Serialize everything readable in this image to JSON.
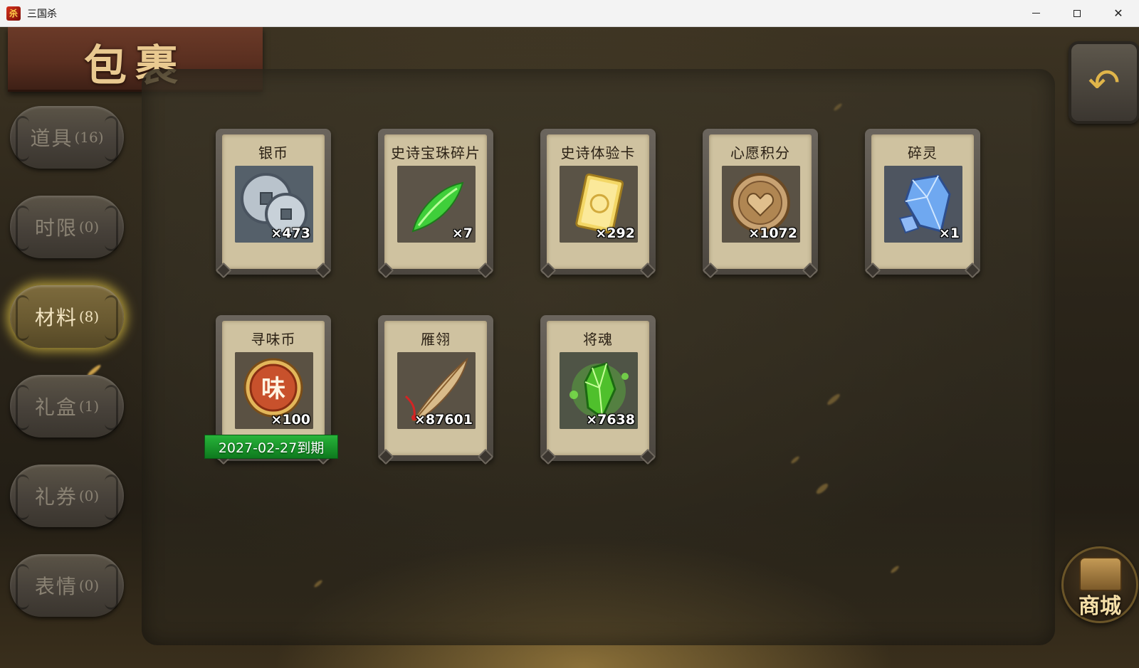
{
  "window": {
    "title": "三国杀",
    "app_icon": "杀",
    "minimize_label": "minimize",
    "maximize_label": "maximize",
    "close_symbol": "✕"
  },
  "header": {
    "title": "包裹"
  },
  "tabs": [
    {
      "name": "道具",
      "count": "(16)",
      "active": false
    },
    {
      "name": "时限",
      "count": "(0)",
      "active": false
    },
    {
      "name": "材料",
      "count": "(8)",
      "active": true
    },
    {
      "name": "礼盒",
      "count": "(1)",
      "active": false
    },
    {
      "name": "礼券",
      "count": "(0)",
      "active": false
    },
    {
      "name": "表情",
      "count": "(0)",
      "active": false
    }
  ],
  "items": [
    {
      "name": "银币",
      "qty": "×473",
      "icon": "silver-coin-icon"
    },
    {
      "name": "史诗宝珠碎片",
      "qty": "×7",
      "icon": "green-jade-shard-icon"
    },
    {
      "name": "史诗体验卡",
      "qty": "×292",
      "icon": "gold-card-icon"
    },
    {
      "name": "心愿积分",
      "qty": "×1072",
      "icon": "heart-coin-icon"
    },
    {
      "name": "碎灵",
      "qty": "×1",
      "icon": "blue-crystal-icon"
    },
    {
      "name": "寻味币",
      "qty": "×100",
      "icon": "taste-coin-icon",
      "expiry": "2027-02-27到期"
    },
    {
      "name": "雁翎",
      "qty": "×87601",
      "icon": "feather-quill-icon"
    },
    {
      "name": "将魂",
      "qty": "×7638",
      "icon": "green-soul-crystal-icon"
    }
  ],
  "back_button": {
    "symbol": "↶"
  },
  "shop": {
    "label": "商城"
  },
  "colors": {
    "active_tab_glow": "#e6c846",
    "expiry_badge": "#1a9a2c",
    "banner": "#5a2f20"
  }
}
